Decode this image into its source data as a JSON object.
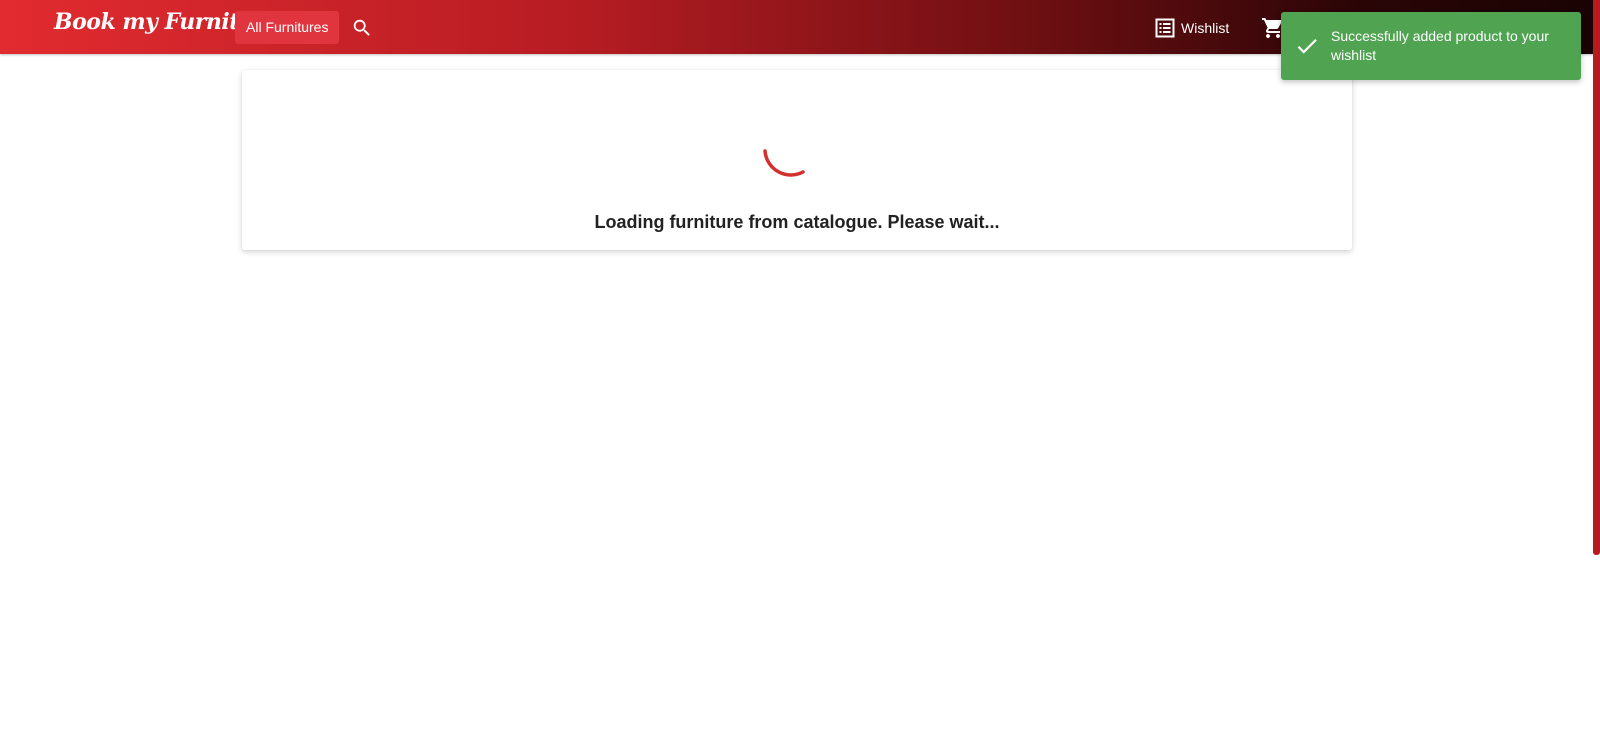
{
  "header": {
    "brand": "Book my Furniture",
    "all_furnitures_label": "All Furnitures",
    "search_icon": "search-icon",
    "wishlist_label": "Wishlist",
    "wishlist_icon": "list-icon",
    "cart_icon": "cart-icon",
    "gradient_start": "#e12b30",
    "gradient_end": "#1a0303"
  },
  "main": {
    "loading_text": "Loading furniture from catalogue. Please wait...",
    "spinner_color": "#d32f2f"
  },
  "toast": {
    "message": "Successfully added product to your wishlist",
    "icon": "check-icon",
    "color": "#4fa351"
  }
}
